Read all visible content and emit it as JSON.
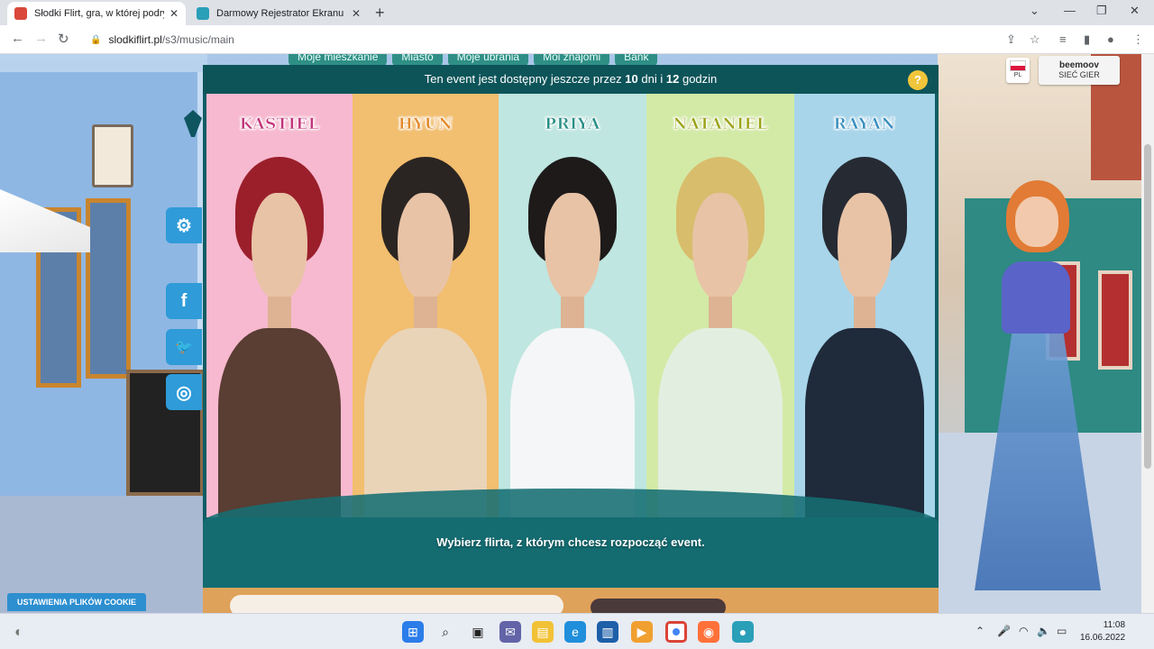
{
  "browser": {
    "tabs": [
      {
        "title": "Słodki Flirt, gra, w której podryw",
        "active": true,
        "favicon_color": "#d9483b"
      },
      {
        "title": "Darmowy Rejestrator Ekranu Onl",
        "active": false,
        "favicon_color": "#2a9fb8"
      }
    ],
    "url_domain": "slodkiflirt.pl",
    "url_path": "/s3/music/main"
  },
  "game": {
    "menu": [
      "Moje mieszkanie",
      "Miasto",
      "Moje ubrania",
      "Moi znajomi",
      "Bank"
    ],
    "event_banner": {
      "prefix": "Ten event jest dostępny jeszcze przez",
      "days": "10",
      "days_label": "dni i",
      "hours": "12",
      "hours_label": "godzin"
    },
    "help_label": "?",
    "characters": [
      {
        "name": "KASTIEL",
        "name_color": "#c2357a",
        "bg": "#f7b9cf",
        "hair": "#9a1f2b",
        "torso": "#5a3d33"
      },
      {
        "name": "HYUN",
        "name_color": "#e3892a",
        "bg": "#f2be6f",
        "hair": "#2a2522",
        "torso": "#e9d4b8"
      },
      {
        "name": "PRIYA",
        "name_color": "#2a8f86",
        "bg": "#bfe6e0",
        "hair": "#1e1a1a",
        "torso": "#f4f6f7"
      },
      {
        "name": "NATANIEL",
        "name_color": "#9ca318",
        "bg": "#d3eaa7",
        "hair": "#d8bd6c",
        "torso": "#e2efe0"
      },
      {
        "name": "RAYAN",
        "name_color": "#3a8fbf",
        "bg": "#a8d5ea",
        "hair": "#262a33",
        "torso": "#1f2a3b"
      }
    ],
    "prompt": "Wybierz flirta, z którym chcesz rozpocząć event.",
    "cookie_button": "USTAWIENIA PLIKÓW COOKIE",
    "lang": "PL",
    "partner_line1": "beemoov",
    "partner_line2": "SIEĆ GIER"
  },
  "social": [
    {
      "icon": "gear-icon",
      "glyph": "⚙"
    },
    {
      "icon": "facebook-icon",
      "glyph": "f"
    },
    {
      "icon": "twitter-icon",
      "glyph": "🐦"
    },
    {
      "icon": "instagram-icon",
      "glyph": "◎"
    }
  ],
  "taskbar": {
    "time": "11:08",
    "date": "16.06.2022"
  }
}
